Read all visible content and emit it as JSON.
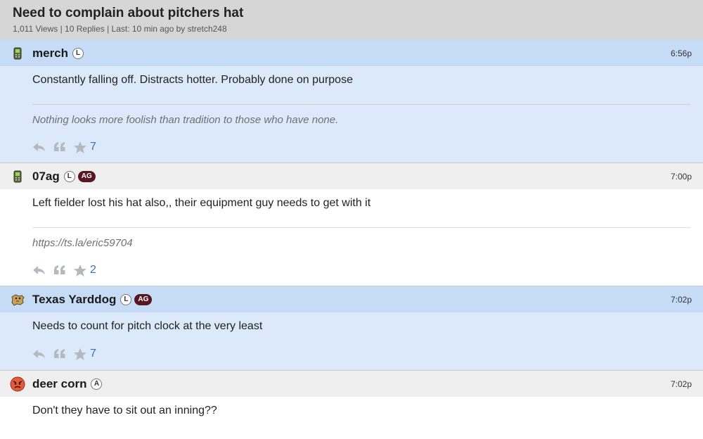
{
  "topic": {
    "title": "Need to complain about pitchers hat",
    "meta": "1,011 Views | 10 Replies | Last: 10 min ago by stretch248"
  },
  "posts": [
    {
      "username": "merch",
      "badge_l": "L",
      "time": "6:56p",
      "text": "Constantly falling off. Distracts hotter. Probably done on purpose",
      "signature": "Nothing looks more foolish than tradition to those who have none.",
      "stars": "7",
      "avatar_icon": "phone-icon"
    },
    {
      "username": "07ag",
      "badge_l": "L",
      "badge_ag": "AG",
      "time": "7:00p",
      "text": "Left fielder lost his hat also,, their equipment guy needs to get with it",
      "signature": "https://ts.la/eric59704",
      "stars": "2",
      "avatar_icon": "phone-icon"
    },
    {
      "username": "Texas Yarddog",
      "badge_l": "L",
      "badge_ag": "AG",
      "time": "7:02p",
      "text": "Needs to count for pitch clock at the very least",
      "stars": "7",
      "avatar_icon": "dog-icon"
    },
    {
      "username": "deer corn",
      "badge_l": "A",
      "time": "7:02p",
      "text": "Don't they have to sit out an inning??",
      "avatar_icon": "angry-face-icon"
    }
  ],
  "colors": {
    "header_bg": "#d6d6d6",
    "post_blue": "#dbe9fa",
    "post_blue_head": "#c6dcf6",
    "post_white_head": "#efefef",
    "badge_ag": "#5a1620",
    "link_blue": "#3b6fb6"
  }
}
